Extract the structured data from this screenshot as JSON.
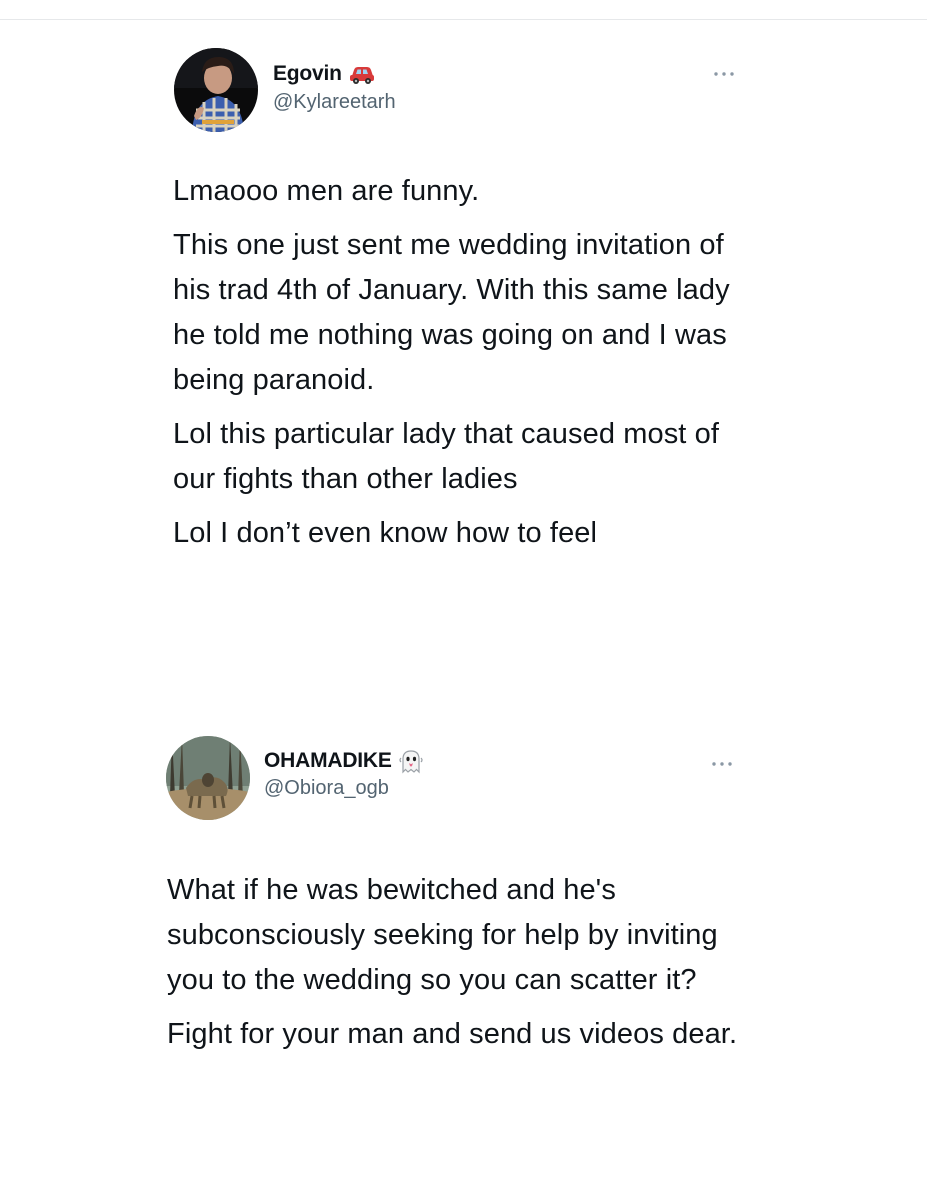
{
  "tweets": [
    {
      "display_name": "Egovin",
      "name_emoji_icon": "red-car-icon",
      "handle": "@Kylareetarh",
      "more_icon": "more-options-icon",
      "paragraphs": [
        "Lmaooo men are funny.",
        "This one just sent me wedding invitation of his trad 4th of January. With this same lady he told me nothing was going on and I was being paranoid.",
        "Lol this particular lady that caused most of our fights than other ladies",
        "Lol I don’t even know how to feel"
      ]
    },
    {
      "display_name": "OHAMADIKE",
      "name_emoji_icon": "ghost-icon",
      "handle": "@Obiora_ogb",
      "more_icon": "more-options-icon",
      "paragraphs": [
        "What if he was bewitched and he's subconsciously seeking for help by inviting you to the wedding so you can scatter it?",
        "Fight for your man and send us videos dear."
      ]
    }
  ],
  "colors": {
    "text_primary": "#0f1419",
    "text_secondary": "#536471",
    "divider": "#e6e8ea",
    "car_red": "#d83a3a",
    "ghost_white": "#f5f5f5"
  }
}
